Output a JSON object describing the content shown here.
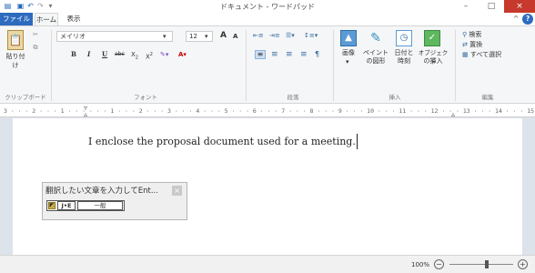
{
  "window": {
    "title": "ドキュメント - ワードパッド",
    "minimize_glyph": "–",
    "maximize_glyph": "□",
    "close_glyph": "×"
  },
  "qat": {
    "icons": [
      "wordpad-app-icon",
      "save-icon",
      "undo-icon",
      "redo-icon",
      "customize-qat-icon"
    ]
  },
  "tabs": {
    "file": "ファイル",
    "home": "ホーム",
    "view": "表示",
    "collapse_glyph": "^",
    "help_glyph": "?"
  },
  "clipboard": {
    "paste_label": "貼り付け",
    "group_label": "クリップボード"
  },
  "font": {
    "font_name": "メイリオ",
    "font_size": "12",
    "grow_glyph": "A",
    "shrink_glyph": "A",
    "bold": "B",
    "italic": "I",
    "underline": "U",
    "strikethrough": "abc",
    "subscript": "X",
    "superscript": "X",
    "group_label": "フォント"
  },
  "paragraph": {
    "group_label": "段落"
  },
  "insert": {
    "picture": "画像",
    "paint_line1": "ペイント",
    "paint_line2": "の図形",
    "datetime_line1": "日付と",
    "datetime_line2": "時刻",
    "object_line1": "オブジェクト",
    "object_line2": "の挿入",
    "group_label": "挿入"
  },
  "editing": {
    "find": "検索",
    "replace": "置換",
    "select_all": "すべて選択",
    "group_label": "編集"
  },
  "ruler": {
    "text": "3 · · · 2 · · · 1 · · · · · · 1 · · · 2 · · · 3 · · · 4 · · · 5 · · · 6 · · · 7 · · · 8 · · · 9 · · · 10 · · · 11 · · · 12 · · · 13 · · · 14 · · · 15 · · · 16 · · · 17 · · · 18"
  },
  "document": {
    "text": "I enclose the proposal document used for a meeting."
  },
  "ime": {
    "title": "翻訳したい文章を入力してEnt...",
    "close_glyph": "×",
    "lang_label": "J•E",
    "mode_label": "一般"
  },
  "status": {
    "zoom": "100%",
    "zoom_out_glyph": "−",
    "zoom_in_glyph": "+",
    "zoom_level": 1.0
  },
  "colors": {
    "file_tab": "#2d6bbf",
    "close_button": "#c7392d",
    "ribbon_bg": "#f5f6f7",
    "canvas_bg": "#dde3ea"
  }
}
